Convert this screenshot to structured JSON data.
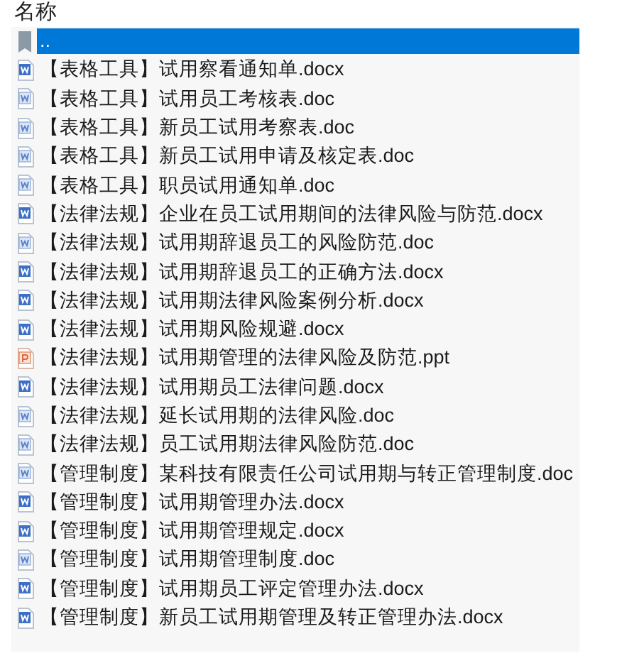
{
  "header": {
    "label": "名称"
  },
  "files": [
    {
      "name": "..",
      "kind": "parent",
      "selected": true
    },
    {
      "name": "【表格工具】试用察看通知单.docx",
      "kind": "docx",
      "selected": false
    },
    {
      "name": "【表格工具】试用员工考核表.doc",
      "kind": "doc",
      "selected": false
    },
    {
      "name": "【表格工具】新员工试用考察表.doc",
      "kind": "doc",
      "selected": false
    },
    {
      "name": "【表格工具】新员工试用申请及核定表.doc",
      "kind": "doc",
      "selected": false
    },
    {
      "name": "【表格工具】职员试用通知单.doc",
      "kind": "doc",
      "selected": false
    },
    {
      "name": "【法律法规】企业在员工试用期间的法律风险与防范.docx",
      "kind": "docx",
      "selected": false
    },
    {
      "name": "【法律法规】试用期辞退员工的风险防范.doc",
      "kind": "doc",
      "selected": false
    },
    {
      "name": "【法律法规】试用期辞退员工的正确方法.docx",
      "kind": "docx",
      "selected": false
    },
    {
      "name": "【法律法规】试用期法律风险案例分析.docx",
      "kind": "docx",
      "selected": false
    },
    {
      "name": "【法律法规】试用期风险规避.docx",
      "kind": "docx",
      "selected": false
    },
    {
      "name": "【法律法规】试用期管理的法律风险及防范.ppt",
      "kind": "ppt",
      "selected": false
    },
    {
      "name": "【法律法规】试用期员工法律问题.docx",
      "kind": "docx",
      "selected": false
    },
    {
      "name": "【法律法规】延长试用期的法律风险.doc",
      "kind": "doc",
      "selected": false
    },
    {
      "name": "【法律法规】员工试用期法律风险防范.doc",
      "kind": "doc",
      "selected": false
    },
    {
      "name": "【管理制度】某科技有限责任公司试用期与转正管理制度.doc",
      "kind": "doc",
      "selected": false
    },
    {
      "name": "【管理制度】试用期管理办法.docx",
      "kind": "docx",
      "selected": false
    },
    {
      "name": "【管理制度】试用期管理规定.docx",
      "kind": "docx",
      "selected": false
    },
    {
      "name": "【管理制度】试用期管理制度.doc",
      "kind": "doc",
      "selected": false
    },
    {
      "name": "【管理制度】试用期员工评定管理办法.docx",
      "kind": "docx",
      "selected": false
    },
    {
      "name": "【管理制度】新员工试用期管理及转正管理办法.docx",
      "kind": "docx",
      "selected": false
    }
  ]
}
